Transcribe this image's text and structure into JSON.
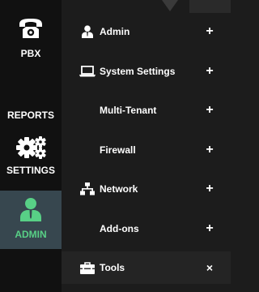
{
  "left_nav": {
    "items": [
      {
        "id": "pbx",
        "label": "PBX",
        "icon": "telephone-icon"
      },
      {
        "id": "reports",
        "label": "REPORTS",
        "icon": null
      },
      {
        "id": "settings",
        "label": "SETTINGS",
        "icon": "gears-icon"
      },
      {
        "id": "admin",
        "label": "ADMIN",
        "icon": "user-icon",
        "active": true
      }
    ],
    "colors": {
      "background": "#111111",
      "active_background": "#37474f",
      "active_text": "#58d086"
    }
  },
  "submenu": {
    "items": [
      {
        "label": "Admin",
        "icon": "user-icon",
        "action": "+"
      },
      {
        "label": "System Settings",
        "icon": "laptop-icon",
        "action": "+"
      },
      {
        "label": "Multi-Tenant",
        "icon": null,
        "action": "+"
      },
      {
        "label": "Firewall",
        "icon": null,
        "action": "+"
      },
      {
        "label": "Network",
        "icon": "network-icon",
        "action": "+"
      },
      {
        "label": "Add-ons",
        "icon": null,
        "action": "+"
      },
      {
        "label": "Tools",
        "icon": "toolbox-icon",
        "action": "×",
        "active": true
      }
    ],
    "colors": {
      "background": "#1c1c1c",
      "active_background": "#242424",
      "text": "#ffffff"
    }
  }
}
